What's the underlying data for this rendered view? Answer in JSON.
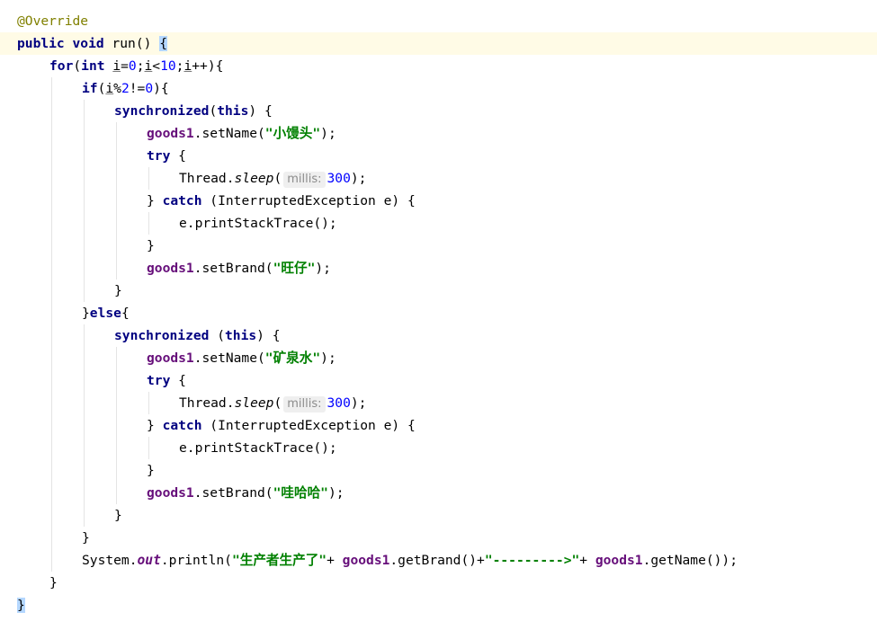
{
  "editor": {
    "lines": [
      {
        "indent": 0,
        "tokens": [
          {
            "t": "ann",
            "v": "@Override"
          }
        ]
      },
      {
        "indent": 0,
        "current": true,
        "tokens": [
          {
            "t": "kw",
            "v": "public"
          },
          {
            "t": "plain",
            "v": " "
          },
          {
            "t": "kw",
            "v": "void"
          },
          {
            "t": "plain",
            "v": " run() "
          },
          {
            "t": "brace",
            "v": "{"
          }
        ]
      },
      {
        "indent": 1,
        "tokens": [
          {
            "t": "kw",
            "v": "for"
          },
          {
            "t": "plain",
            "v": "("
          },
          {
            "t": "kw",
            "v": "int"
          },
          {
            "t": "plain",
            "v": " "
          },
          {
            "t": "local",
            "v": "i"
          },
          {
            "t": "plain",
            "v": "="
          },
          {
            "t": "num",
            "v": "0"
          },
          {
            "t": "plain",
            "v": ";"
          },
          {
            "t": "local",
            "v": "i"
          },
          {
            "t": "plain",
            "v": "<"
          },
          {
            "t": "num",
            "v": "10"
          },
          {
            "t": "plain",
            "v": ";"
          },
          {
            "t": "local",
            "v": "i"
          },
          {
            "t": "plain",
            "v": "++){"
          }
        ]
      },
      {
        "indent": 2,
        "tokens": [
          {
            "t": "kw",
            "v": "if"
          },
          {
            "t": "plain",
            "v": "("
          },
          {
            "t": "local",
            "v": "i"
          },
          {
            "t": "plain",
            "v": "%"
          },
          {
            "t": "num",
            "v": "2"
          },
          {
            "t": "plain",
            "v": "!="
          },
          {
            "t": "num",
            "v": "0"
          },
          {
            "t": "plain",
            "v": "){"
          }
        ]
      },
      {
        "indent": 3,
        "tokens": [
          {
            "t": "kw",
            "v": "synchronized"
          },
          {
            "t": "plain",
            "v": "("
          },
          {
            "t": "kw",
            "v": "this"
          },
          {
            "t": "plain",
            "v": ") {"
          }
        ]
      },
      {
        "indent": 4,
        "tokens": [
          {
            "t": "field",
            "v": "goods1"
          },
          {
            "t": "plain",
            "v": ".setName("
          },
          {
            "t": "str",
            "v": "\"小馒头\""
          },
          {
            "t": "plain",
            "v": ");"
          }
        ]
      },
      {
        "indent": 4,
        "tokens": [
          {
            "t": "kw",
            "v": "try"
          },
          {
            "t": "plain",
            "v": " {"
          }
        ]
      },
      {
        "indent": 5,
        "tokens": [
          {
            "t": "plain",
            "v": "Thread."
          },
          {
            "t": "smethod",
            "v": "sleep"
          },
          {
            "t": "plain",
            "v": "("
          },
          {
            "t": "hint",
            "v": "millis:"
          },
          {
            "t": "num",
            "v": "300"
          },
          {
            "t": "plain",
            "v": ");"
          }
        ]
      },
      {
        "indent": 4,
        "tokens": [
          {
            "t": "plain",
            "v": "} "
          },
          {
            "t": "kw",
            "v": "catch"
          },
          {
            "t": "plain",
            "v": " (InterruptedException e) {"
          }
        ]
      },
      {
        "indent": 5,
        "tokens": [
          {
            "t": "plain",
            "v": "e.printStackTrace();"
          }
        ]
      },
      {
        "indent": 4,
        "tokens": [
          {
            "t": "plain",
            "v": "}"
          }
        ]
      },
      {
        "indent": 4,
        "tokens": [
          {
            "t": "field",
            "v": "goods1"
          },
          {
            "t": "plain",
            "v": ".setBrand("
          },
          {
            "t": "str",
            "v": "\"旺仔\""
          },
          {
            "t": "plain",
            "v": ");"
          }
        ]
      },
      {
        "indent": 3,
        "tokens": [
          {
            "t": "plain",
            "v": "}"
          }
        ]
      },
      {
        "indent": 2,
        "tokens": [
          {
            "t": "plain",
            "v": "}"
          },
          {
            "t": "kw",
            "v": "else"
          },
          {
            "t": "plain",
            "v": "{"
          }
        ]
      },
      {
        "indent": 3,
        "tokens": [
          {
            "t": "kw",
            "v": "synchronized"
          },
          {
            "t": "plain",
            "v": " ("
          },
          {
            "t": "kw",
            "v": "this"
          },
          {
            "t": "plain",
            "v": ") {"
          }
        ]
      },
      {
        "indent": 4,
        "tokens": [
          {
            "t": "field",
            "v": "goods1"
          },
          {
            "t": "plain",
            "v": ".setName("
          },
          {
            "t": "str",
            "v": "\"矿泉水\""
          },
          {
            "t": "plain",
            "v": ");"
          }
        ]
      },
      {
        "indent": 4,
        "tokens": [
          {
            "t": "kw",
            "v": "try"
          },
          {
            "t": "plain",
            "v": " {"
          }
        ]
      },
      {
        "indent": 5,
        "tokens": [
          {
            "t": "plain",
            "v": "Thread."
          },
          {
            "t": "smethod",
            "v": "sleep"
          },
          {
            "t": "plain",
            "v": "("
          },
          {
            "t": "hint",
            "v": "millis:"
          },
          {
            "t": "num",
            "v": "300"
          },
          {
            "t": "plain",
            "v": ");"
          }
        ]
      },
      {
        "indent": 4,
        "tokens": [
          {
            "t": "plain",
            "v": "} "
          },
          {
            "t": "kw",
            "v": "catch"
          },
          {
            "t": "plain",
            "v": " (InterruptedException e) {"
          }
        ]
      },
      {
        "indent": 5,
        "tokens": [
          {
            "t": "plain",
            "v": "e.printStackTrace();"
          }
        ]
      },
      {
        "indent": 4,
        "tokens": [
          {
            "t": "plain",
            "v": "}"
          }
        ]
      },
      {
        "indent": 4,
        "tokens": [
          {
            "t": "field",
            "v": "goods1"
          },
          {
            "t": "plain",
            "v": ".setBrand("
          },
          {
            "t": "str",
            "v": "\"哇哈哈\""
          },
          {
            "t": "plain",
            "v": ");"
          }
        ]
      },
      {
        "indent": 3,
        "tokens": [
          {
            "t": "plain",
            "v": "}"
          }
        ]
      },
      {
        "indent": 2,
        "tokens": [
          {
            "t": "plain",
            "v": "}"
          }
        ]
      },
      {
        "indent": 2,
        "tokens": [
          {
            "t": "plain",
            "v": "System."
          },
          {
            "t": "static",
            "v": "out"
          },
          {
            "t": "plain",
            "v": ".println("
          },
          {
            "t": "str",
            "v": "\"生产者生产了\""
          },
          {
            "t": "plain",
            "v": "+ "
          },
          {
            "t": "field",
            "v": "goods1"
          },
          {
            "t": "plain",
            "v": ".getBrand()+"
          },
          {
            "t": "str",
            "v": "\"--------->\""
          },
          {
            "t": "plain",
            "v": "+ "
          },
          {
            "t": "field",
            "v": "goods1"
          },
          {
            "t": "plain",
            "v": ".getName());"
          }
        ]
      },
      {
        "indent": 1,
        "tokens": [
          {
            "t": "plain",
            "v": "}"
          }
        ]
      },
      {
        "indent": 0,
        "tokens": [
          {
            "t": "brace",
            "v": "}"
          }
        ]
      }
    ]
  },
  "colors": {
    "keyword": "#000080",
    "annotation": "#808000",
    "number": "#0000ff",
    "string": "#008000",
    "field": "#660e7a",
    "current_line": "#fffbe6",
    "brace_match": "#b4d7ff"
  }
}
